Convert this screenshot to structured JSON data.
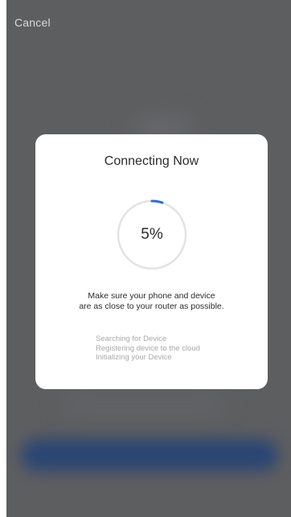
{
  "header": {
    "cancel_label": "Cancel"
  },
  "dialog": {
    "title": "Connecting Now",
    "progress_percent": 5,
    "progress_label": "5%",
    "advice_lines": [
      "Make sure your phone and device",
      "are as close to your router as possible."
    ],
    "steps": [
      "Searching for Device",
      "Registering device to the cloud",
      "Initializing your Device"
    ]
  },
  "colors": {
    "progress_accent": "#2f6bdc",
    "progress_track": "#e3e3e3",
    "backdrop": "#5d5e60"
  }
}
